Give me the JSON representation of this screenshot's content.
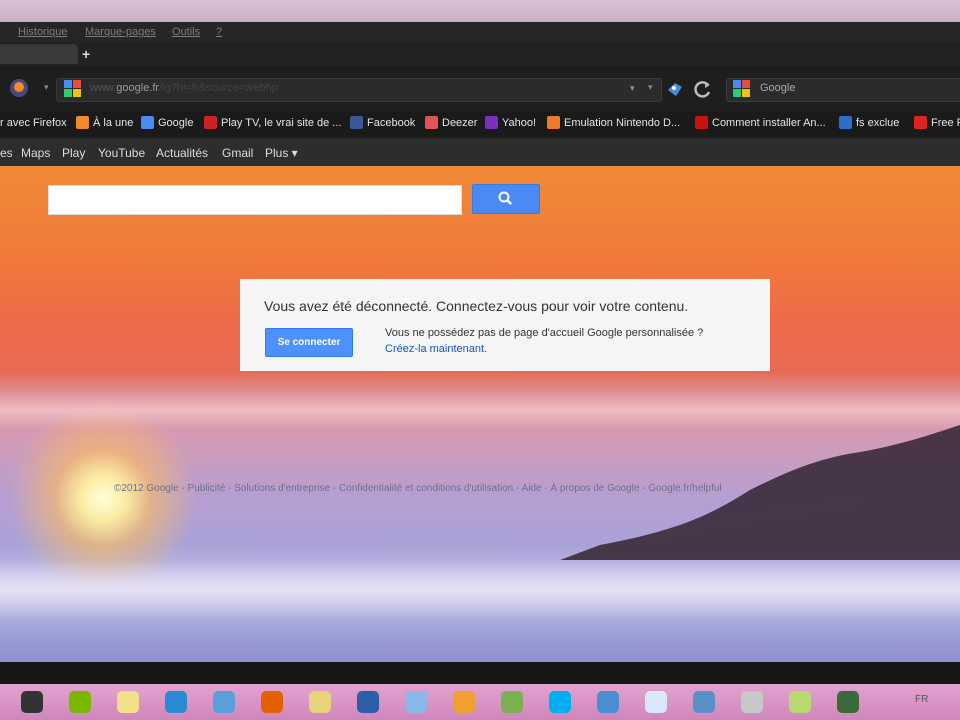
{
  "menu": {
    "items": [
      "Historique",
      "Marque-pages",
      "Outils",
      "?"
    ]
  },
  "tabs": {
    "new_tab": "+"
  },
  "navbar": {
    "url_domain": "google.fr",
    "url_rest": "/ig?hl=fr&source=webhp",
    "search_engine_label": "Google"
  },
  "bookmarks": [
    {
      "label": "r avec Firefox",
      "icon": "firefox-icon",
      "color": "#e66000"
    },
    {
      "label": "À la une",
      "icon": "rss-icon",
      "color": "#f08a2a"
    },
    {
      "label": "Google",
      "icon": "google-icon",
      "color": "#4a8af4"
    },
    {
      "label": "Play TV, le vrai site de ...",
      "icon": "playtv-icon",
      "color": "#cc2222"
    },
    {
      "label": "Facebook",
      "icon": "facebook-icon",
      "color": "#3b5998"
    },
    {
      "label": "Deezer",
      "icon": "deezer-icon",
      "color": "#e05555"
    },
    {
      "label": "Yahoo!",
      "icon": "yahoo-icon",
      "color": "#7b2fbf"
    },
    {
      "label": "Emulation Nintendo D...",
      "icon": "emulation-icon",
      "color": "#f07a2a"
    },
    {
      "label": "Comment installer An...",
      "icon": "youtube-icon",
      "color": "#cc1111"
    },
    {
      "label": "fs exclue",
      "icon": "fs-icon",
      "color": "#2c6ecb"
    },
    {
      "label": "Free R",
      "icon": "free-icon",
      "color": "#d22"
    }
  ],
  "gbar": {
    "links": [
      "es",
      "Maps",
      "Play",
      "YouTube",
      "Actualités",
      "Gmail",
      "Plus ▾"
    ]
  },
  "content": {
    "search_value": "",
    "signout_message": "Vous avez été déconnecté. Connectez-vous pour voir votre contenu.",
    "signin_button": "Se connecter",
    "no_homepage": "Vous ne possédez pas de page d'accueil Google personnalisée ?",
    "create_link": "Créez-la maintenant.",
    "footer": "©2012 Google - Publicité - Solutions d'entreprise - Confidentialité et conditions d'utilisation - Aide - À propos de Google - Google.fr/helpful"
  },
  "taskbar": {
    "apps": [
      {
        "name": "ereader-icon",
        "color": "#333333"
      },
      {
        "name": "spotify-icon",
        "color": "#7ab800"
      },
      {
        "name": "notepad-icon",
        "color": "#f2e08a"
      },
      {
        "name": "internet-explorer-icon",
        "color": "#2a8ad4"
      },
      {
        "name": "network-icon",
        "color": "#5aa0d8"
      },
      {
        "name": "firefox-icon",
        "color": "#e66000"
      },
      {
        "name": "folder-icon",
        "color": "#e8d27a"
      },
      {
        "name": "bird-app-icon",
        "color": "#2d5ea8"
      },
      {
        "name": "window-app-icon",
        "color": "#8ab8e8"
      },
      {
        "name": "media-player-icon",
        "color": "#f0a030"
      },
      {
        "name": "chart-app-icon",
        "color": "#7ab050"
      },
      {
        "name": "skype-icon",
        "color": "#00aff0"
      },
      {
        "name": "speedometer-icon",
        "color": "#4a90d0"
      },
      {
        "name": "document-icon",
        "color": "#d8e8f8"
      },
      {
        "name": "photo-viewer-icon",
        "color": "#5a90c8"
      },
      {
        "name": "disc-icon",
        "color": "#c8c8c8"
      },
      {
        "name": "notes-icon",
        "color": "#b8d870"
      },
      {
        "name": "camera-app-icon",
        "color": "#3a6a3a"
      }
    ],
    "language": "FR"
  }
}
